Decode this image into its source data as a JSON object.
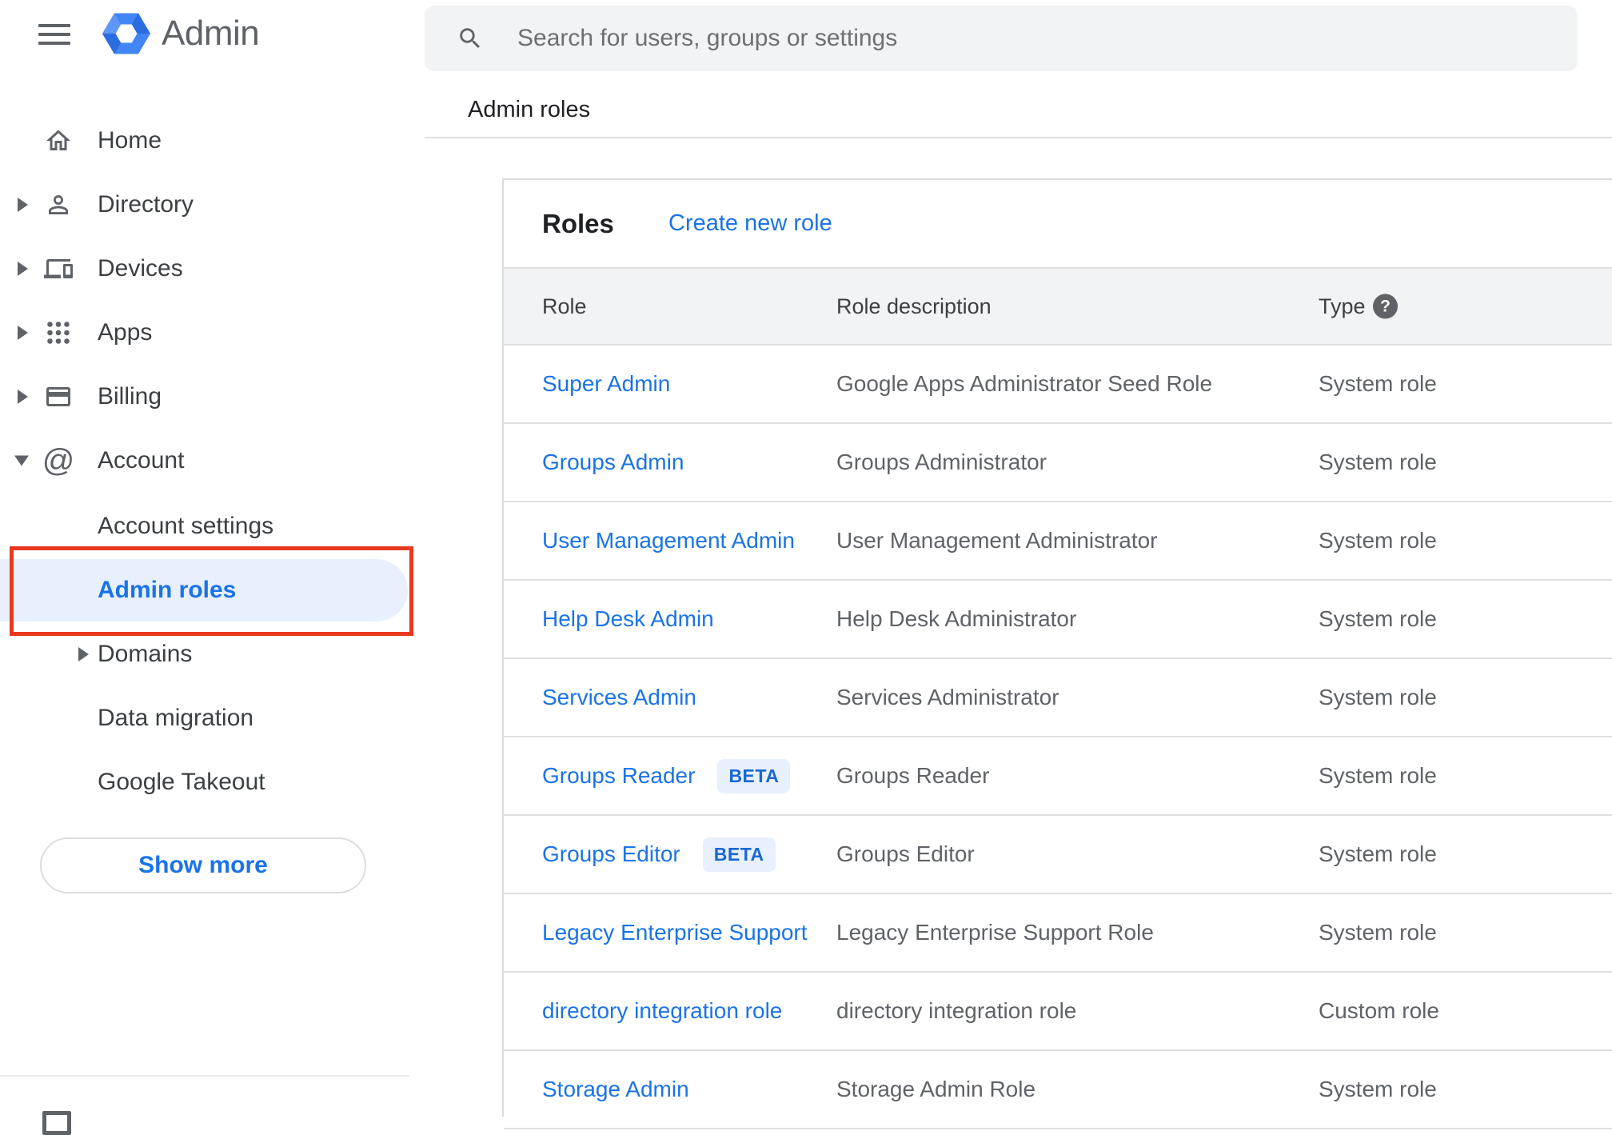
{
  "header": {
    "app_title": "Admin",
    "search_placeholder": "Search for users, groups or settings"
  },
  "breadcrumb": "Admin roles",
  "sidebar": {
    "items": [
      {
        "label": "Home",
        "icon": "home-icon",
        "expandable": false
      },
      {
        "label": "Directory",
        "icon": "person-icon",
        "expandable": true
      },
      {
        "label": "Devices",
        "icon": "devices-icon",
        "expandable": true
      },
      {
        "label": "Apps",
        "icon": "apps-grid-icon",
        "expandable": true
      },
      {
        "label": "Billing",
        "icon": "credit-card-icon",
        "expandable": true
      },
      {
        "label": "Account",
        "icon": "at-icon",
        "expandable": true,
        "expanded": true
      }
    ],
    "account_children": [
      {
        "label": "Account settings",
        "expandable": false,
        "selected": false
      },
      {
        "label": "Admin roles",
        "expandable": false,
        "selected": true
      },
      {
        "label": "Domains",
        "expandable": true,
        "selected": false
      },
      {
        "label": "Data migration",
        "expandable": false,
        "selected": false
      },
      {
        "label": "Google Takeout",
        "expandable": false,
        "selected": false
      }
    ],
    "show_more_label": "Show more"
  },
  "main": {
    "card_title": "Roles",
    "create_link": "Create new role",
    "table": {
      "columns": [
        "Role",
        "Role description",
        "Type"
      ],
      "beta_label": "BETA",
      "rows": [
        {
          "role": "Super Admin",
          "beta": false,
          "description": "Google Apps Administrator Seed Role",
          "type": "System role"
        },
        {
          "role": "Groups Admin",
          "beta": false,
          "description": "Groups Administrator",
          "type": "System role"
        },
        {
          "role": "User Management Admin",
          "beta": false,
          "description": "User Management Administrator",
          "type": "System role"
        },
        {
          "role": "Help Desk Admin",
          "beta": false,
          "description": "Help Desk Administrator",
          "type": "System role"
        },
        {
          "role": "Services Admin",
          "beta": false,
          "description": "Services Administrator",
          "type": "System role"
        },
        {
          "role": "Groups Reader",
          "beta": true,
          "description": "Groups Reader",
          "type": "System role"
        },
        {
          "role": "Groups Editor",
          "beta": true,
          "description": "Groups Editor",
          "type": "System role"
        },
        {
          "role": "Legacy Enterprise Support",
          "beta": false,
          "description": "Legacy Enterprise Support Role",
          "type": "System role"
        },
        {
          "role": "directory integration role",
          "beta": false,
          "description": "directory integration role",
          "type": "Custom role"
        },
        {
          "role": "Storage Admin",
          "beta": false,
          "description": "Storage Admin Role",
          "type": "System role"
        }
      ]
    }
  },
  "colors": {
    "accent_blue": "#1a73e8",
    "selected_item_bg": "#e8f0fe",
    "annotation_red": "#e8391f",
    "beta_badge_bg": "#e8f0fe",
    "beta_badge_text": "#1967d2",
    "table_header_bg": "#f1f3f4",
    "icon_gray": "#5f6368",
    "logo_blue": "#4285f4"
  }
}
